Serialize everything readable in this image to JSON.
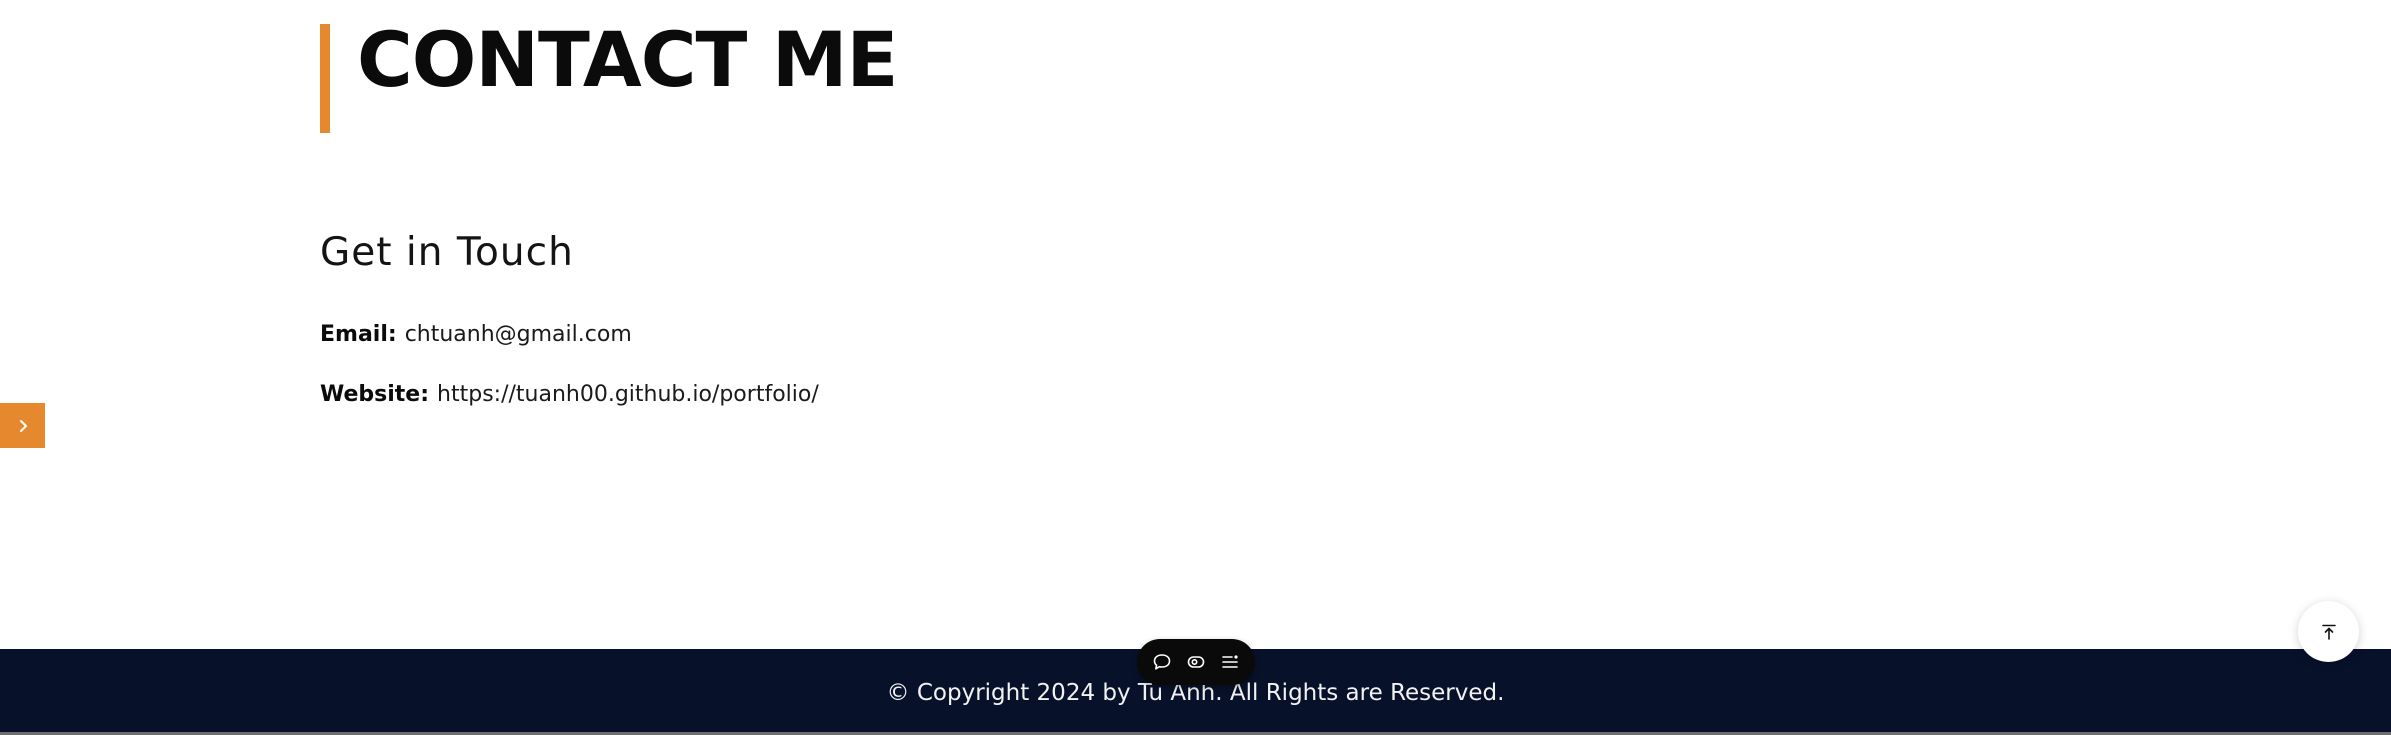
{
  "section": {
    "title": "CONTACT ME",
    "subheading": "Get in Touch"
  },
  "contact": {
    "email_label": "Email:",
    "email_value": "chtuanh@gmail.com",
    "website_label": "Website:",
    "website_value": "https://tuanh00.github.io/portfolio/"
  },
  "footer": {
    "copyright": "© Copyright 2024 by Tu Anh. All Rights are Reserved."
  },
  "icons": {
    "side_toggle": "chevron-right-icon",
    "toolbar": [
      "chat-icon",
      "eye-icon",
      "menu-icon"
    ],
    "back_to_top": "arrow-up-to-top-icon"
  },
  "colors": {
    "accent": "#e6882e",
    "footer_bg": "#08112a",
    "text": "#0b0b0b"
  }
}
